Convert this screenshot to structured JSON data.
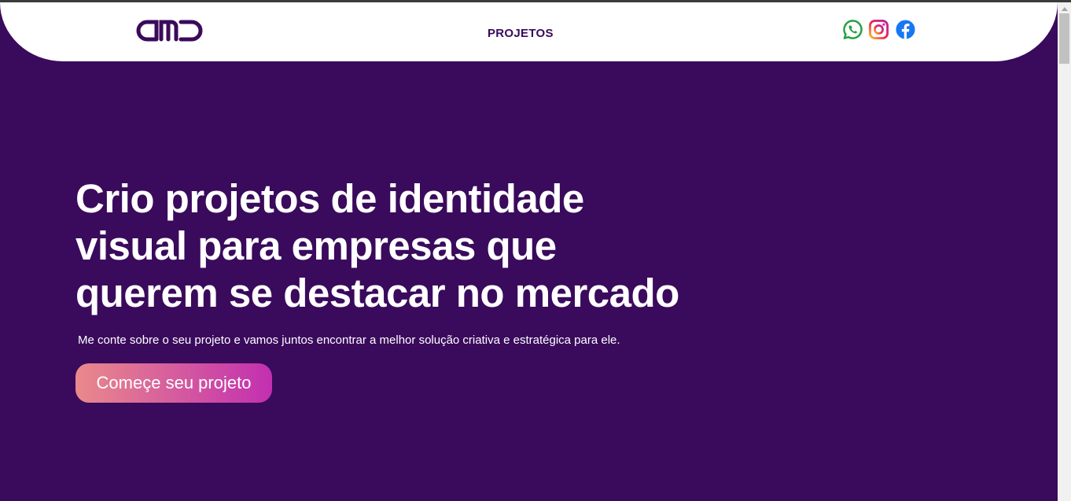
{
  "header": {
    "logo_text": "amd",
    "nav_label": "PROJETOS",
    "social": [
      {
        "name": "WhatsApp",
        "icon": "whatsapp-icon",
        "color": "#25a244"
      },
      {
        "name": "Instagram",
        "icon": "instagram-icon",
        "color": "#e1306c"
      },
      {
        "name": "Facebook",
        "icon": "facebook-icon",
        "color": "#1877f2"
      }
    ]
  },
  "hero": {
    "title_line1": "Crio projetos de identidade",
    "title_line2": "visual para empresas que",
    "title_line3": "querem se destacar no mercado",
    "subtitle": "Me conte sobre o seu projeto e vamos juntos encontrar a melhor solução criativa e estratégica para ele.",
    "cta_label": "Começe seu projeto"
  },
  "colors": {
    "brand_purple": "#3a0a5c",
    "cta_gradient_start": "#e98a8b",
    "cta_gradient_end": "#c22fb0"
  }
}
